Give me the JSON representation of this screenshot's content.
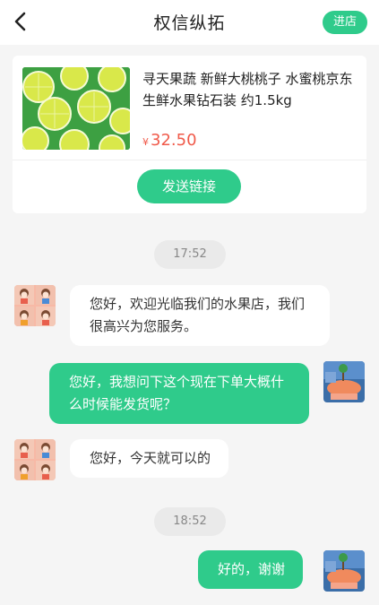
{
  "header": {
    "title": "权信纵拓",
    "store_button": "进店"
  },
  "product": {
    "name": "寻天果蔬 新鲜大桃桃子 水蜜桃京东生鲜水果钻石装 约1.5kg",
    "currency": "¥",
    "price": "32.50",
    "send_link_label": "发送链接"
  },
  "messages": {
    "time1": "17:52",
    "msg1": "您好，欢迎光临我们的水果店，我们很高兴为您服务。",
    "msg2": "您好，我想问下这个现在下单大概什么时候能发货呢？",
    "msg3": "您好，今天就可以的",
    "time2": "18:52",
    "msg4": "好的，谢谢"
  },
  "colors": {
    "accent": "#2fcb8b",
    "price": "#f05a4a",
    "background": "#f5f5f5"
  },
  "icons": {
    "back": "chevron-left-icon",
    "product": "lime-slices-image",
    "seller_avatar": "cartoon-girl-avatar",
    "user_avatar": "landscape-avatar"
  }
}
